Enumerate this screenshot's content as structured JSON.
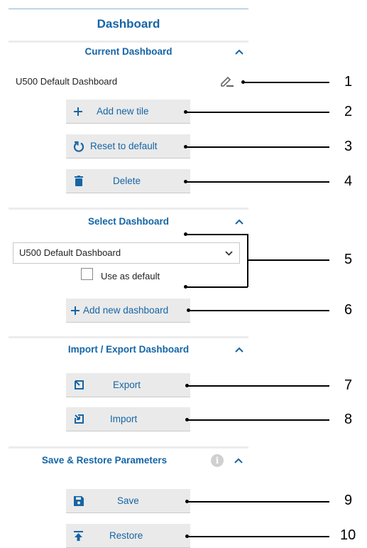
{
  "panel": {
    "title": "Dashboard"
  },
  "current": {
    "heading": "Current Dashboard",
    "dashboard_name": "U500 Default Dashboard",
    "add_tile": "Add new tile",
    "reset": "Reset to default",
    "delete": "Delete"
  },
  "select": {
    "heading": "Select Dashboard",
    "selected": "U500 Default Dashboard",
    "use_default": "Use as default",
    "add_dashboard": "Add new dashboard"
  },
  "import_export": {
    "heading": "Import / Export Dashboard",
    "export": "Export",
    "import": "Import"
  },
  "save_restore": {
    "heading": "Save & Restore Parameters",
    "info": "i",
    "save": "Save",
    "restore": "Restore"
  },
  "callouts": [
    "1",
    "2",
    "3",
    "4",
    "5",
    "6",
    "7",
    "8",
    "9",
    "10"
  ],
  "colors": {
    "accent": "#1565a6",
    "button_bg": "#eaeaea"
  },
  "icons": [
    "edit-icon",
    "plus-icon",
    "reset-icon",
    "trash-icon",
    "chevron-up-icon",
    "chevron-down-icon",
    "export-icon",
    "import-icon",
    "save-icon",
    "restore-icon",
    "info-icon"
  ]
}
